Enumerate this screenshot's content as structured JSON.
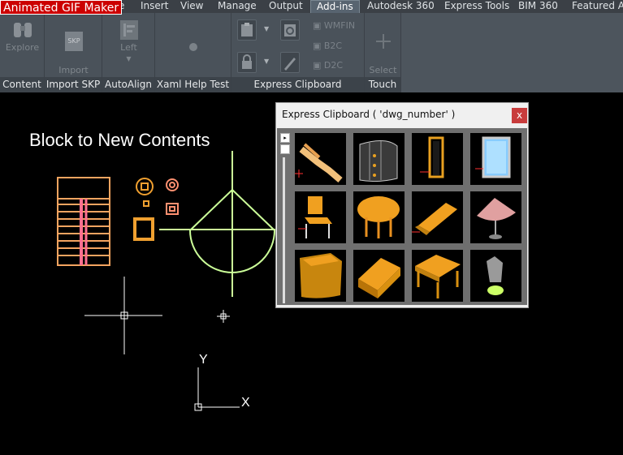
{
  "badge": "Animated GIF Maker",
  "tabs": [
    {
      "label": "e",
      "active": false
    },
    {
      "label": "Insert",
      "active": false
    },
    {
      "label": "View",
      "active": false
    },
    {
      "label": "Manage",
      "active": false
    },
    {
      "label": "Output",
      "active": false
    },
    {
      "label": "Add-ins",
      "active": true
    },
    {
      "label": "Autodesk 360",
      "active": false
    },
    {
      "label": "Express Tools",
      "active": false
    },
    {
      "label": "BIM 360",
      "active": false
    },
    {
      "label": "Featured Ap",
      "active": false
    }
  ],
  "ribbon": {
    "content": {
      "title": "Content",
      "explore_label": "Explore"
    },
    "import_skp": {
      "title": "Import SKP",
      "import_label": "Import\nSKP File",
      "icon_text": "SKP"
    },
    "autoalign": {
      "title": "AutoAlign",
      "left_label": "Left"
    },
    "xaml": {
      "title": "Xaml Help Test"
    },
    "express_clipboard": {
      "title": "Express Clipboard",
      "wmfin": "WMFIN",
      "b2c": "B2C",
      "d2c": "D2C"
    },
    "touch": {
      "title": "Touch",
      "select_mode_label": "Select\nMode"
    }
  },
  "drawing": {
    "title": "Block to New Contents",
    "ucs_y": "Y",
    "ucs_x": "X"
  },
  "palette": {
    "title": "Express Clipboard ( 'dwg_number' )",
    "close": "x",
    "items": [
      "stairs",
      "curved-wall",
      "door",
      "window",
      "chair",
      "round-table",
      "sofa",
      "table-lamp",
      "tub-chair",
      "armchair",
      "coffee-table",
      "plant"
    ]
  },
  "colors": {
    "ribbon_bg": "#4a525a",
    "panel_title_bg": "#3c434a",
    "tab_bar_bg": "#3b4046",
    "cad_background": "#000000",
    "cad_orange": "#f4a460",
    "cad_green": "#ccff99",
    "furniture_orange": "#e8a020",
    "close_red": "#c83c3c"
  }
}
